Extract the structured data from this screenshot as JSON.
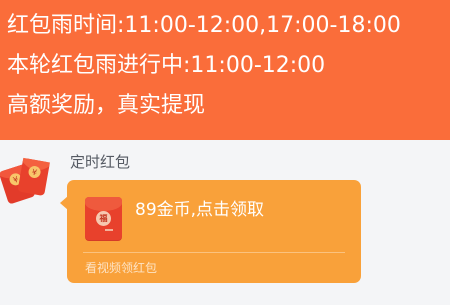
{
  "banner": {
    "lines": [
      "红包雨时间:11:00-12:00,17:00-18:00",
      "本轮红包雨进行中:11:00-12:00",
      "高额奖励，真实提现"
    ]
  },
  "message": {
    "sender": "定时红包",
    "envelope_icon": "red-envelope-icon",
    "text": "89金币,点击领取",
    "footer": "看视频领红包"
  },
  "colors": {
    "banner_bg": "#fa6d3a",
    "bubble_bg": "#f9a13a",
    "envelope_red": "#e8412c",
    "page_bg": "#f4f5f7"
  }
}
